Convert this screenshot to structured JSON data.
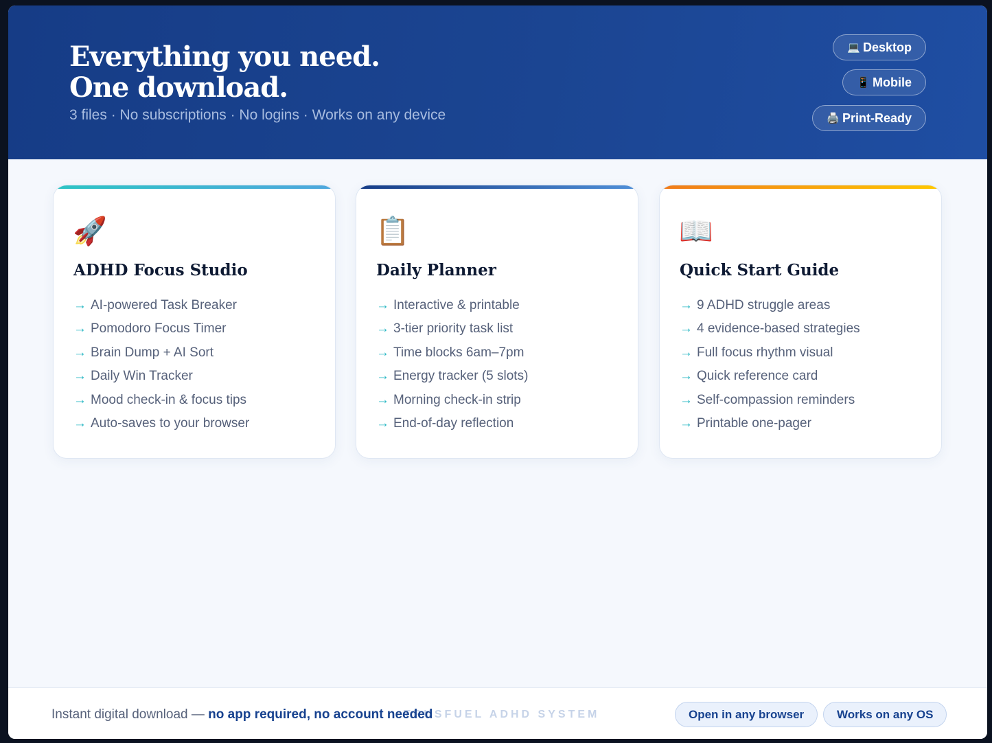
{
  "hero": {
    "title_line1": "Everything you need.",
    "title_line2": "One download.",
    "subtitle": "3 files · No subscriptions · No logins · Works on any device",
    "badges": [
      {
        "icon": "💻",
        "icon_name": "laptop-icon",
        "label": "Desktop"
      },
      {
        "icon": "📱",
        "icon_name": "phone-icon",
        "label": "Mobile"
      },
      {
        "icon": "🖨️",
        "icon_name": "printer-icon",
        "label": "Print-Ready"
      }
    ]
  },
  "cards": [
    {
      "icon": "🚀",
      "icon_name": "rocket-icon",
      "title": "ADHD Focus Studio",
      "accent": "#2cc4c4",
      "features": [
        "AI-powered Task Breaker",
        "Pomodoro Focus Timer",
        "Brain Dump + AI Sort",
        "Daily Win Tracker",
        "Mood check-in & focus tips",
        "Auto-saves to your browser"
      ]
    },
    {
      "icon": "📋",
      "icon_name": "clipboard-icon",
      "title": "Daily Planner",
      "accent": "#163c86",
      "features": [
        "Interactive & printable",
        "3-tier priority task list",
        "Time blocks 6am–7pm",
        "Energy tracker (5 slots)",
        "Morning check-in strip",
        "End-of-day reflection"
      ]
    },
    {
      "icon": "📖",
      "icon_name": "book-icon",
      "title": "Quick Start Guide",
      "accent": "#f07a1a",
      "features": [
        "9 ADHD struggle areas",
        "4 evidence-based strategies",
        "Full focus rhythm visual",
        "Quick reference card",
        "Self-compassion reminders",
        "Printable one-pager"
      ]
    }
  ],
  "arrow": "→",
  "footer": {
    "note_plain": "Instant digital download — ",
    "note_bold": "no app required, no account needed",
    "watermark": "TRUSFUEL ADHD SYSTEM",
    "buttons": [
      "Open in any browser",
      "Works on any OS"
    ]
  },
  "colors": {
    "hero_bg": "#1b4592",
    "page_bg": "#f5f8fd",
    "arrow": "#2bb8c4",
    "footer_accent": "#17428f"
  }
}
